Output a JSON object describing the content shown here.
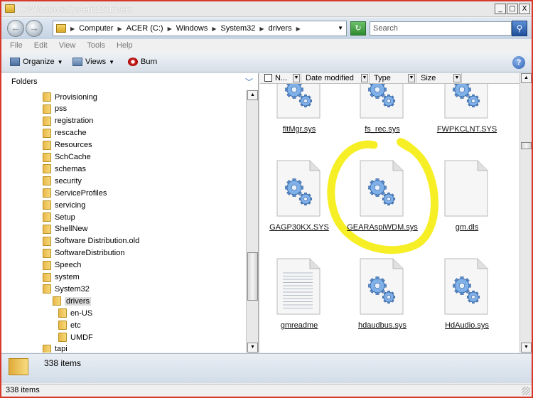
{
  "window": {
    "title": "C:\\Windows\\System32\\drivers",
    "min_label": "_",
    "max_label": "□",
    "close_label": "X"
  },
  "nav": {
    "back_glyph": "←",
    "forward_glyph": "→",
    "breadcrumbs": [
      "Computer",
      "ACER (C:)",
      "Windows",
      "System32",
      "drivers"
    ],
    "search_placeholder": "Search",
    "refresh_glyph": "↻",
    "search_glyph": "⚲"
  },
  "menu": [
    "File",
    "Edit",
    "View",
    "Tools",
    "Help"
  ],
  "toolbar": {
    "organize": "Organize",
    "views": "Views",
    "burn": "Burn",
    "help": "?"
  },
  "folders_pane": {
    "heading": "Folders",
    "items": [
      {
        "label": "Provisioning",
        "level": 0
      },
      {
        "label": "pss",
        "level": 0
      },
      {
        "label": "registration",
        "level": 0
      },
      {
        "label": "rescache",
        "level": 0
      },
      {
        "label": "Resources",
        "level": 0
      },
      {
        "label": "SchCache",
        "level": 0
      },
      {
        "label": "schemas",
        "level": 0
      },
      {
        "label": "security",
        "level": 0
      },
      {
        "label": "ServiceProfiles",
        "level": 0
      },
      {
        "label": "servicing",
        "level": 0
      },
      {
        "label": "Setup",
        "level": 0
      },
      {
        "label": "ShellNew",
        "level": 0
      },
      {
        "label": "Software Distribution.old",
        "level": 0
      },
      {
        "label": "SoftwareDistribution",
        "level": 0
      },
      {
        "label": "Speech",
        "level": 0
      },
      {
        "label": "system",
        "level": 0
      },
      {
        "label": "System32",
        "level": 0
      },
      {
        "label": "drivers",
        "level": 1,
        "selected": true
      },
      {
        "label": "en-US",
        "level": 2
      },
      {
        "label": "etc",
        "level": 2
      },
      {
        "label": "UMDF",
        "level": 2
      },
      {
        "label": "tapi",
        "level": 0
      }
    ]
  },
  "columns": [
    "N...",
    "Date modified",
    "Type",
    "Size"
  ],
  "files": [
    {
      "name": "fltMgr.sys",
      "icon": "gear-file-icon"
    },
    {
      "name": "fs_rec.sys",
      "icon": "gear-file-icon"
    },
    {
      "name": "FWPKCLNT.SYS",
      "icon": "gear-file-icon"
    },
    {
      "name": "GAGP30KX.SYS",
      "icon": "gear-file-icon"
    },
    {
      "name": "GEARAspiWDM.sys",
      "icon": "gear-file-icon",
      "highlighted": true
    },
    {
      "name": "gm.dls",
      "icon": "blank-file-icon"
    },
    {
      "name": "gmreadme",
      "icon": "text-file-icon"
    },
    {
      "name": "hdaudbus.sys",
      "icon": "gear-file-icon"
    },
    {
      "name": "HdAudio.sys",
      "icon": "gear-file-icon"
    }
  ],
  "details": {
    "count": "338 items"
  },
  "status": {
    "text": "338 items"
  },
  "colors": {
    "highlight": "#f5ee1a",
    "border": "#d8382a"
  }
}
